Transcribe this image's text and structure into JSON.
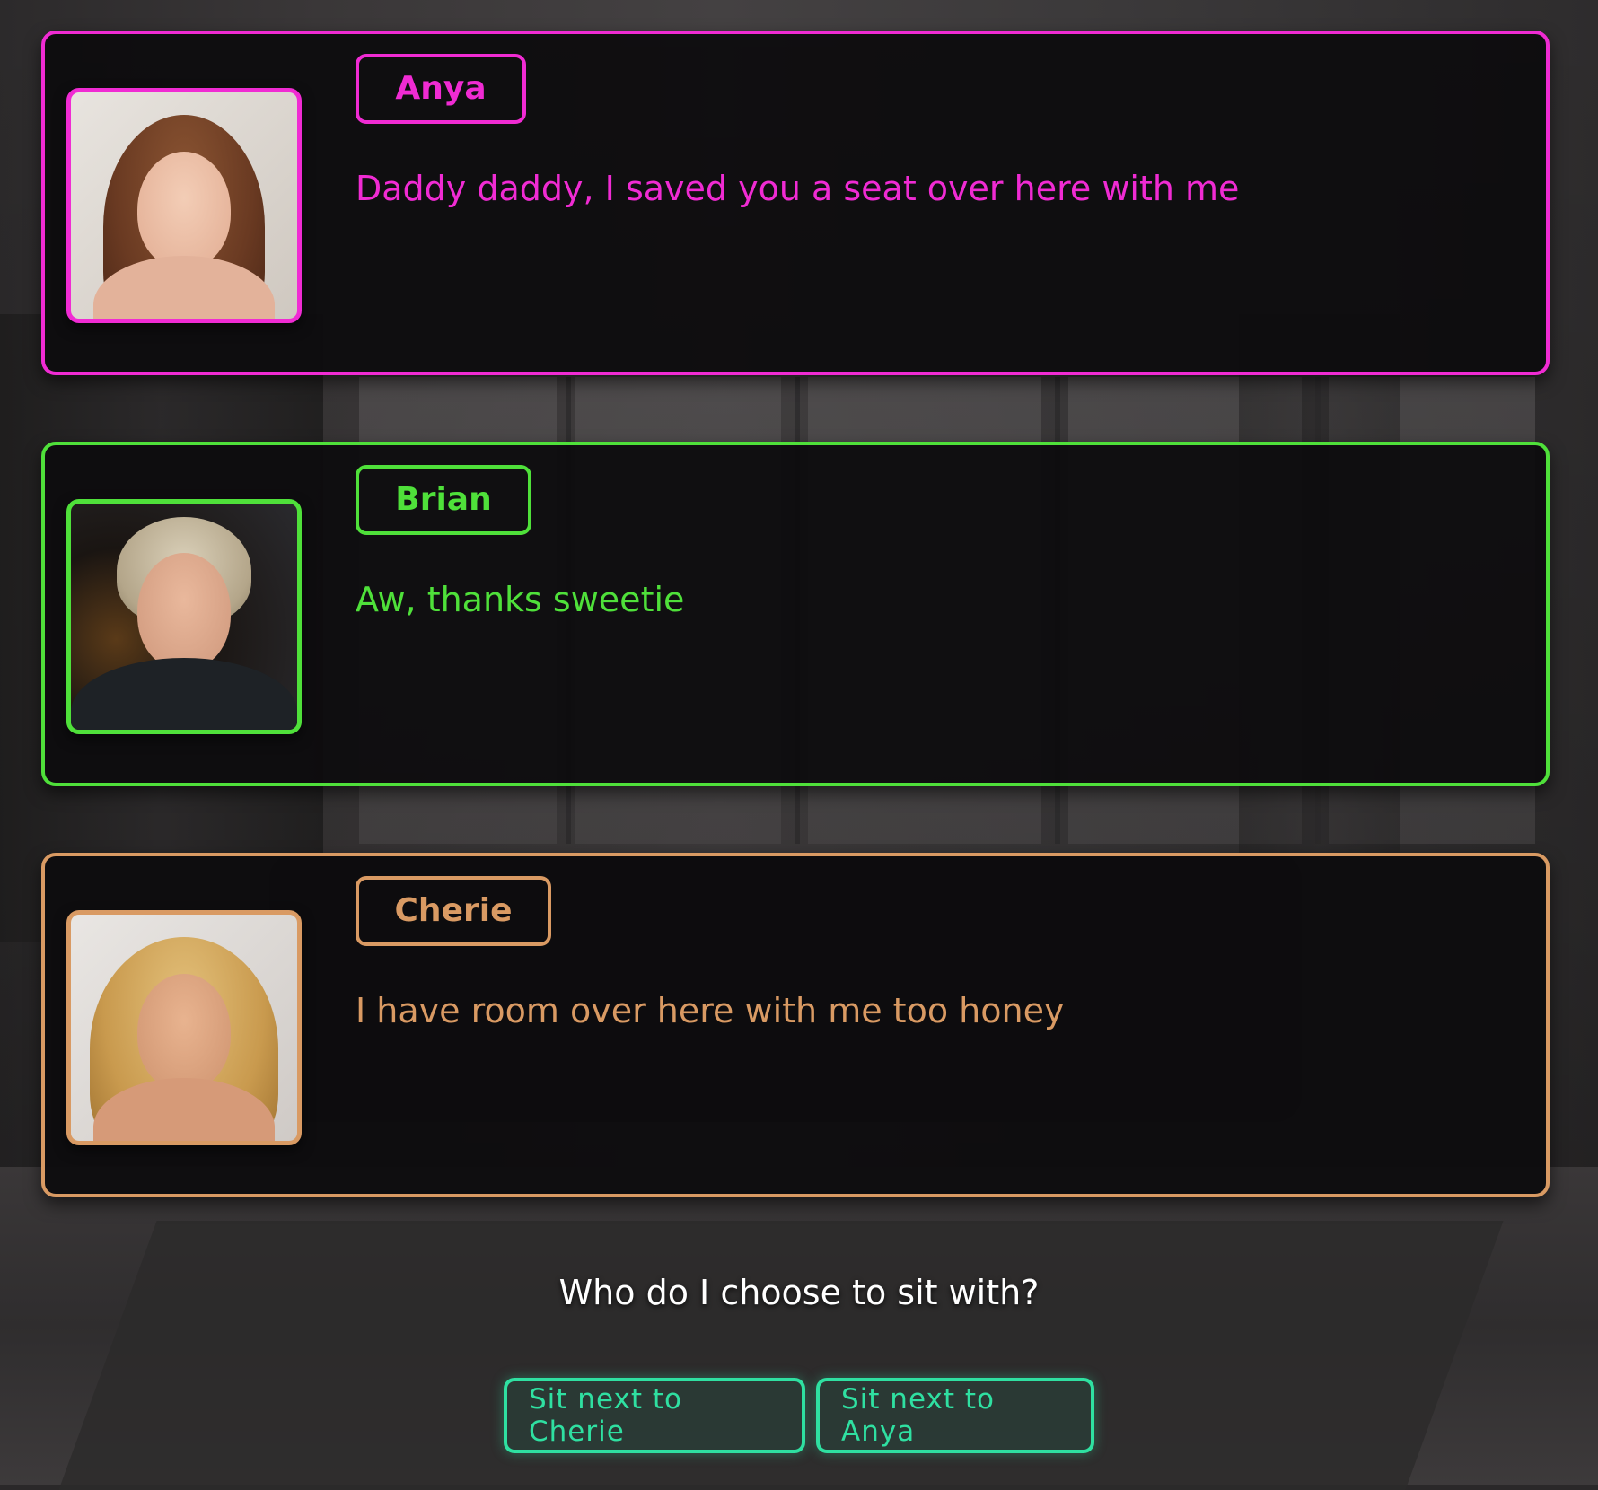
{
  "colors": {
    "anya": "#f02bd3",
    "brian": "#4fe03a",
    "cherie": "#d99a63",
    "choice_accent": "#2fe0a1",
    "prompt_text": "#ffffff"
  },
  "dialogue": [
    {
      "speaker": "Anya",
      "message": "Daddy daddy, I saved you a seat over here with me",
      "portrait_icon": "anya-portrait"
    },
    {
      "speaker": "Brian",
      "message": "Aw, thanks sweetie",
      "portrait_icon": "brian-portrait"
    },
    {
      "speaker": "Cherie",
      "message": "I have room over here with me too honey",
      "portrait_icon": "cherie-portrait"
    }
  ],
  "prompt": "Who do I choose to sit with?",
  "choices": [
    {
      "label": "Sit next to Cherie"
    },
    {
      "label": "Sit next to Anya"
    }
  ]
}
